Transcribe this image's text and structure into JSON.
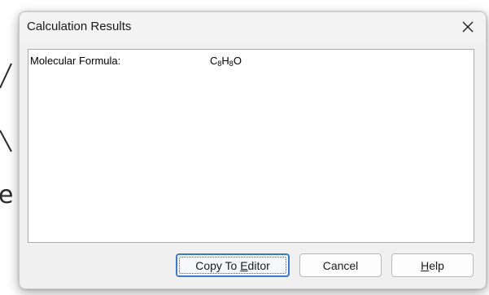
{
  "dialog": {
    "title": "Calculation Results",
    "close_icon": "close-icon"
  },
  "results": {
    "label": "Molecular Formula:",
    "formula_parts": {
      "c": "C",
      "c_count": "8",
      "h": "H",
      "h_count": "8",
      "o": "O"
    }
  },
  "buttons": {
    "copy_prefix": "Copy To ",
    "copy_mnemonic": "E",
    "copy_rest": "ditor",
    "cancel": "Cancel",
    "help_mnemonic": "H",
    "help_rest": "elp"
  },
  "background": {
    "partial_letter": "e"
  },
  "colors": {
    "dialog_bg": "#f0f0f0",
    "panel_bg": "#ffffff",
    "focus_border": "#3a7bc8"
  }
}
